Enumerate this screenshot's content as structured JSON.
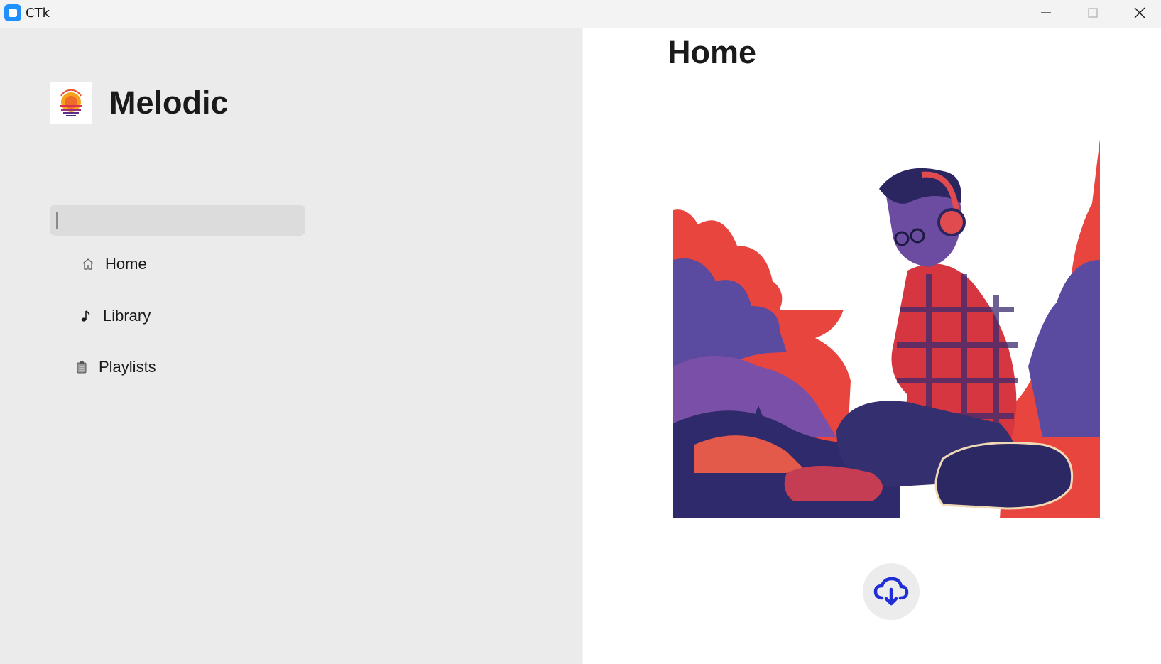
{
  "window": {
    "title": "CTk",
    "controls": [
      "minimize",
      "maximize",
      "close"
    ]
  },
  "sidebar": {
    "brand": "Melodic",
    "search": {
      "value": "",
      "placeholder": ""
    },
    "items": [
      {
        "label": "Home",
        "icon": "home-icon"
      },
      {
        "label": "Library",
        "icon": "music-note-icon"
      },
      {
        "label": "Playlists",
        "icon": "clipboard-icon"
      }
    ]
  },
  "main": {
    "title": "Home",
    "hero_image": "illustration-man-with-headphones",
    "download_icon": "cloud-download-icon",
    "accent_color": "#1f2ed6"
  }
}
